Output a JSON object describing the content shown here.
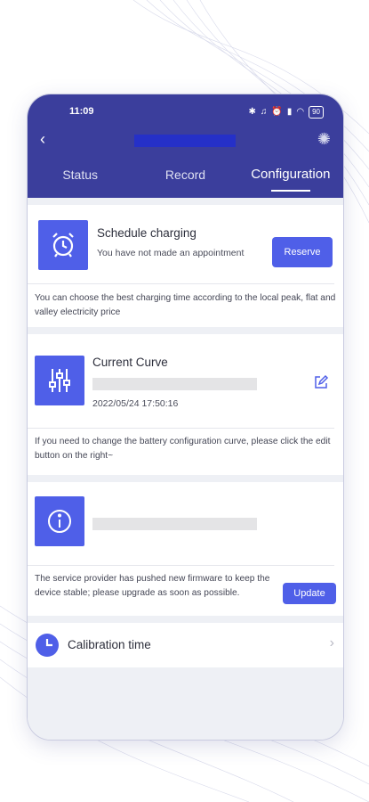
{
  "status_bar": {
    "time": "11:09",
    "battery": "90"
  },
  "tabs": [
    {
      "label": "Status"
    },
    {
      "label": "Record"
    },
    {
      "label": "Configuration"
    }
  ],
  "schedule": {
    "title": "Schedule charging",
    "subtitle": "You have not made an appointment",
    "button": "Reserve",
    "note": "You can choose the best charging time according to the local peak, flat and valley electricity price"
  },
  "curve": {
    "title": "Current Curve",
    "date": "2022/05/24 17:50:16",
    "note": "If you need to change the battery configuration curve, please click the edit button on the right~"
  },
  "firmware": {
    "note": "The service provider has pushed new firmware to keep the device stable; please upgrade as soon as possible.",
    "button": "Update"
  },
  "calibration": {
    "label": "Calibration time"
  },
  "colors": {
    "header": "#3b3e9c",
    "accent": "#4f5fe8",
    "background": "#eef0f5"
  },
  "icons": [
    "back-icon",
    "settings-icon",
    "alarm-clock-icon",
    "sliders-icon",
    "edit-icon",
    "info-icon",
    "clock-icon",
    "chevron-right-icon"
  ]
}
